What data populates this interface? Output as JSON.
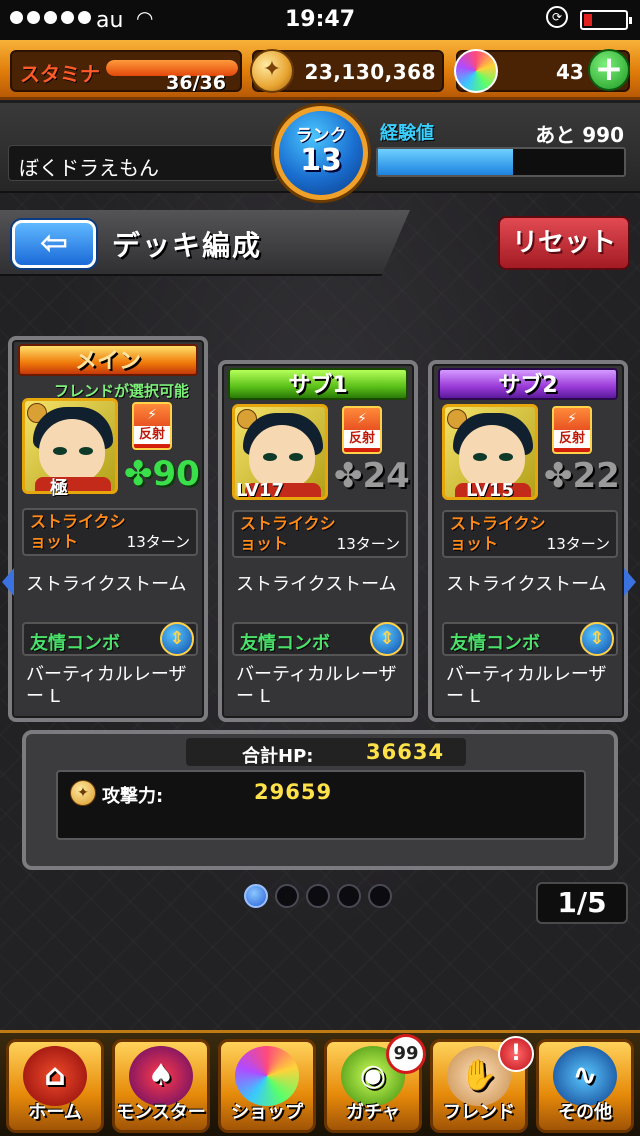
{
  "status_bar": {
    "carrier": "au",
    "time": "19:47",
    "battery_level": 0.2
  },
  "header": {
    "stamina_label": "スタミナ",
    "stamina_value": "36/36",
    "stamina_fraction": 1.0,
    "coins": "23,130,368",
    "orbs": "43",
    "plus_symbol": "+"
  },
  "user": {
    "name": "ぼくドラえもん",
    "rank_label": "ランク",
    "rank": "13",
    "exp_label": "経験値",
    "exp_remaining": "あと 990",
    "exp_fraction": 0.55
  },
  "page": {
    "back_symbol": "⇦",
    "title": "デッキ編成",
    "reset_label": "リセット"
  },
  "cards": [
    {
      "tab": "メイン",
      "friend_note": "フレンドが選択可能",
      "ability": "反射",
      "plus_value": "✤90",
      "level": "極",
      "strike_label": "ストライクショット",
      "strike_turns": "13ターン",
      "strike_name": "ストライクストーム",
      "combo_label": "友情コンボ",
      "combo_name": "バーティカルレーザー L"
    },
    {
      "tab": "サブ1",
      "ability": "反射",
      "plus_value": "✤24",
      "level": "LV17",
      "strike_label": "ストライクショット",
      "strike_turns": "13ターン",
      "strike_name": "ストライクストーム",
      "combo_label": "友情コンボ",
      "combo_name": "バーティカルレーザー L"
    },
    {
      "tab": "サブ2",
      "ability": "反射",
      "plus_value": "✤22",
      "level": "LV15",
      "strike_label": "ストライクショット",
      "strike_turns": "13ターン",
      "strike_name": "ストライクストーム",
      "combo_label": "友情コンボ",
      "combo_name": "バーティカルレーザー L"
    }
  ],
  "stats": {
    "hp_label": "合計HP:",
    "hp_value": "36634",
    "atk_label": "攻撃力:",
    "atk_value": "29659"
  },
  "pager": {
    "page_indicator": "1/5",
    "current_page": 1,
    "total_pages": 5
  },
  "nav": {
    "home": "ホーム",
    "monster": "モンスター",
    "shop": "ショップ",
    "gacha": "ガチャ",
    "friend": "フレンド",
    "other": "その他",
    "gacha_badge": "99",
    "friend_badge": "!"
  },
  "colors": {
    "header_orange": "#e07d0a",
    "rank_blue": "#1a6ed0",
    "reset_red": "#a31b24",
    "main_tab": "#f07a0a",
    "sub1_tab": "#5ac018",
    "sub2_tab": "#9a3ad8"
  }
}
